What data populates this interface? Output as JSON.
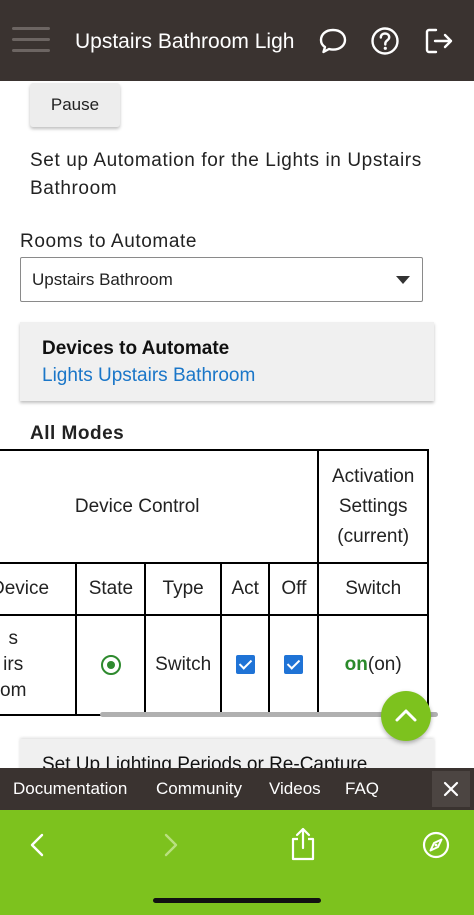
{
  "header": {
    "title": "Upstairs Bathroom Ligh"
  },
  "main": {
    "pause_label": "Pause",
    "setup_heading": "Set up Automation for the Lights in Upstairs Bathroom",
    "rooms_label": "Rooms to Automate",
    "rooms_selected": "Upstairs Bathroom",
    "devices_title": "Devices to Automate",
    "devices_link": "Lights Upstairs Bathroom",
    "modes_title": "All Modes",
    "table": {
      "group_device_control": "Device Control",
      "group_activation": "Activation Settings (current)",
      "columns": [
        "Device",
        "State",
        "Type",
        "Act",
        "Off",
        "Switch"
      ],
      "rows": [
        {
          "device": "Lights Upstairs Bathroom",
          "device_lines": [
            "s",
            "irs",
            "om"
          ],
          "state": "on",
          "type": "Switch",
          "act": true,
          "off": true,
          "switch_value": "on",
          "switch_current": "(on)"
        }
      ]
    },
    "lighting_card_text": "Set Up Lighting Periods or Re-Capture"
  },
  "bottom_links": [
    "Documentation",
    "Community",
    "Videos",
    "FAQ"
  ],
  "colors": {
    "header_bg": "#3a3330",
    "accent_green": "#7dc21e",
    "link_blue": "#1a76c8",
    "device_purple": "#7a1a85",
    "state_green": "#2e8a2e",
    "checkbox_blue": "#1f73d6"
  },
  "icons": {
    "menu": "hamburger-icon",
    "chat": "chat-bubble-icon",
    "help": "question-circle-icon",
    "logout": "logout-icon",
    "scroll_top": "chevron-up-icon",
    "close": "close-icon",
    "back": "chevron-left-icon",
    "forward": "chevron-right-icon",
    "share": "share-icon",
    "compass": "compass-icon"
  }
}
